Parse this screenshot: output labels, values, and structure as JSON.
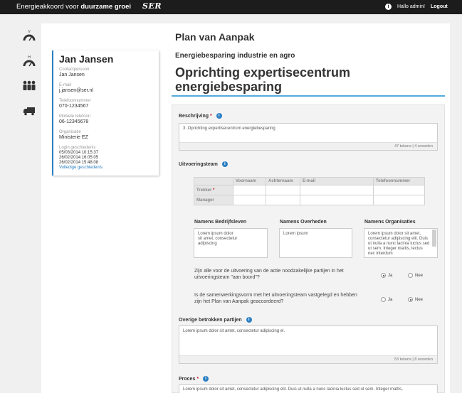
{
  "topbar": {
    "brand_plain": "Energieakkoord voor",
    "brand_bold": "duurzame groei",
    "logo": "SER",
    "admin": "Hallo admin!",
    "logout": "Logout"
  },
  "rail": {
    "item1_letter": "V",
    "item2_letter": "H"
  },
  "person": {
    "name": "Jan Jansen",
    "contact_label": "Contactpersoon",
    "contact": "Jan Jansen",
    "email_label": "E-mail",
    "email": "j.jansen@ser.nl",
    "phone_label": "Telefoonnummer",
    "phone": "070-1234567",
    "mobile_label": "Mobiele telefoon",
    "mobile": "06-12345678",
    "org_label": "Organisatie",
    "org": "Ministerie EZ",
    "login_label": "Login geschiedenis",
    "logins": [
      "05/03/2014 10:15:37",
      "26/02/2014 16:05:05",
      "26/02/2014 15:48:08"
    ],
    "history_link": "Volledige geschiedenis"
  },
  "page": {
    "title": "Plan van Aanpak",
    "subtitle": "Energiebesparing industrie en agro",
    "main_title": "Oprichting expertisecentrum energiebesparing"
  },
  "form": {
    "beschrijving": {
      "label": "Beschrijving",
      "value": "3. Oprichting expertisecentrum energiebesparing",
      "counter": "47 tekens | 4 woorden"
    },
    "team": {
      "label": "Uitvoeringsteam",
      "columns": [
        "",
        "Voornaam",
        "Achternaam",
        "E-mail",
        "Telefoonnummer"
      ],
      "rows": [
        "Trekker",
        "Manager"
      ]
    },
    "namens": {
      "bedrijfsleven": {
        "label": "Namens Bedrijfsleven",
        "value": "Lorem ipsum dolor\n sit amet, consectetur\n adipiscing"
      },
      "overheden": {
        "label": "Namens Overheden",
        "value": "Lorem ipsum"
      },
      "organisaties": {
        "label": "Namens Organisaties",
        "value": "Lorem ipsum dolor sit amet, consectetur adipiscing elit. Duis ut nulla a nunc lacinia luctus sed ut sem. Integer mattis, lectus nec interdum"
      }
    },
    "q1": {
      "text": "Zijn alle voor de uitvoering van de actie noodzakelijke partijen in het uitvoeringsteam \"aan boord\"?",
      "yes": "Ja",
      "no": "Nee",
      "selected": "Ja"
    },
    "q2": {
      "text": "Is de samenwerkingsvorm met het uitvoeringsteam vastgelegd en hebben zijn het Plan van Aanpak geaccordeerd?",
      "yes": "Ja",
      "no": "Nee",
      "selected": "Nee"
    },
    "overige": {
      "label": "Overige betrokken partijen",
      "value": "Lorem ipsum dolor sit amet, consectetur adipiscing el.",
      "counter": "53 tekens | 8 woorden"
    },
    "proces": {
      "label": "Proces",
      "value": "Lorem ipsum dolor sit amet, consectetur adipiscing elit. Duis ut nulla a nunc lacinia luctus sed ut sem. Integer mattis,"
    },
    "required_mark": "*",
    "help_glyph": "i"
  }
}
